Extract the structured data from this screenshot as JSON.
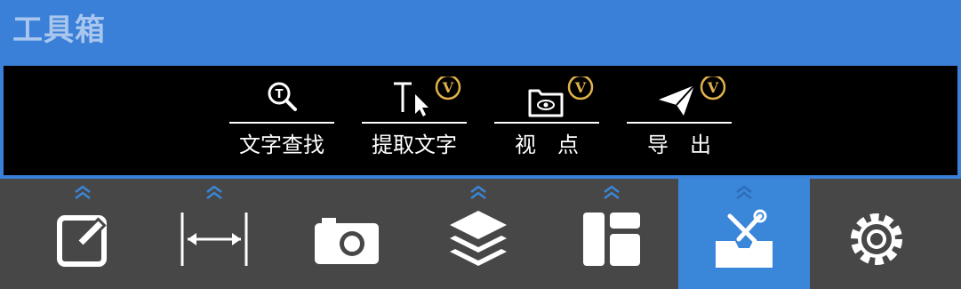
{
  "panel": {
    "title": "工具箱"
  },
  "tools": [
    {
      "label": "文字查找",
      "icon": "text-search-icon",
      "vip": false
    },
    {
      "label": "提取文字",
      "icon": "text-extract-icon",
      "vip": true,
      "badge": "V"
    },
    {
      "label": "视　点",
      "icon": "viewpoint-icon",
      "vip": true,
      "badge": "V"
    },
    {
      "label": "导　出",
      "icon": "export-icon",
      "vip": true,
      "badge": "V"
    }
  ],
  "bottom_nav": [
    {
      "icon": "edit-icon",
      "expandable": true,
      "active": false
    },
    {
      "icon": "measure-icon",
      "expandable": true,
      "active": false
    },
    {
      "icon": "camera-icon",
      "expandable": false,
      "active": false
    },
    {
      "icon": "layers-icon",
      "expandable": true,
      "active": false
    },
    {
      "icon": "layout-icon",
      "expandable": true,
      "active": false
    },
    {
      "icon": "toolbox-icon",
      "expandable": true,
      "active": true
    },
    {
      "icon": "settings-icon",
      "expandable": false,
      "active": false
    }
  ],
  "colors": {
    "panel_blue": "#3a7fd8",
    "active_blue": "#3a86d8",
    "vip_gold": "#e0b24a",
    "bar_gray": "#474747",
    "chevron_blue": "#3a86d8"
  }
}
